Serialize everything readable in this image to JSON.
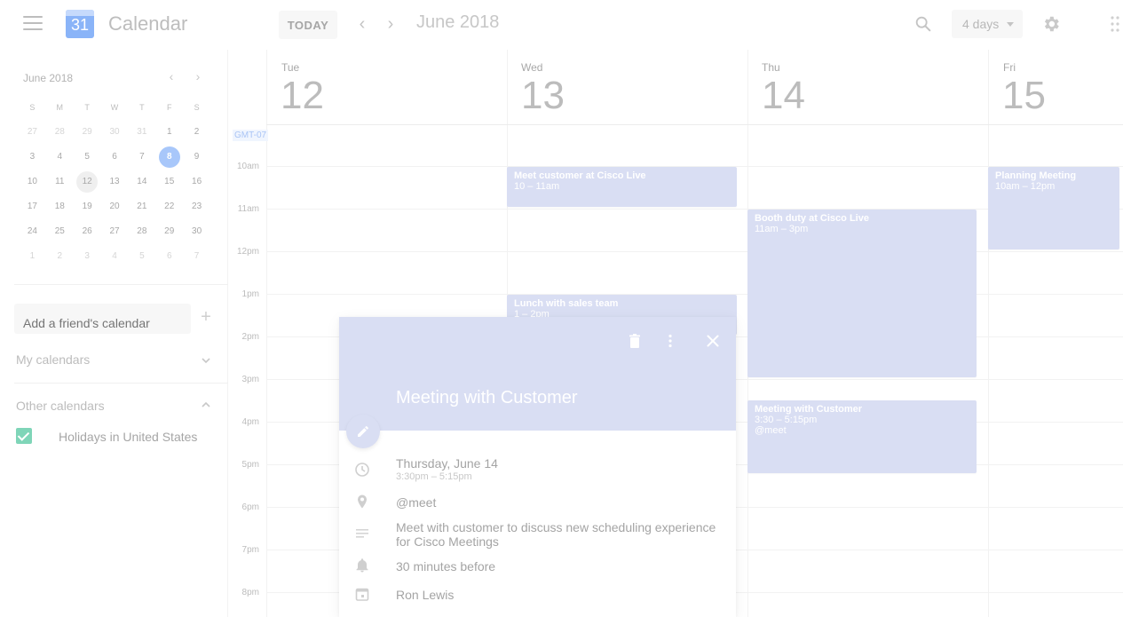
{
  "app": {
    "title": "Calendar",
    "logo_text": "31"
  },
  "toolbar": {
    "today_label": "TODAY",
    "prev_label": "‹",
    "next_label": "›",
    "month_title": "June 2018",
    "view_label": "4 days"
  },
  "mini_calendar": {
    "title": "June 2018",
    "prev_label": "‹",
    "next_label": "›",
    "weekdays": [
      "S",
      "M",
      "T",
      "W",
      "T",
      "F",
      "S"
    ],
    "weeks": [
      [
        "27",
        "28",
        "29",
        "30",
        "31",
        "1",
        "2"
      ],
      [
        "3",
        "4",
        "5",
        "6",
        "7",
        "8",
        "9"
      ],
      [
        "10",
        "11",
        "12",
        "13",
        "14",
        "15",
        "16"
      ],
      [
        "17",
        "18",
        "19",
        "20",
        "21",
        "22",
        "23"
      ],
      [
        "24",
        "25",
        "26",
        "27",
        "28",
        "29",
        "30"
      ],
      [
        "1",
        "2",
        "3",
        "4",
        "5",
        "6",
        "7"
      ]
    ],
    "today": "8",
    "selected": "12"
  },
  "sidebar": {
    "friend_placeholder": "Add a friend's calendar",
    "my_calendars": "My calendars",
    "other_calendars": "Other calendars",
    "calendars": [
      {
        "label": "Holidays in United States",
        "checked": true,
        "color": "#7fd5b8"
      }
    ]
  },
  "grid": {
    "timezone": "GMT-07",
    "days": [
      {
        "dow": "Tue",
        "num": "12"
      },
      {
        "dow": "Wed",
        "num": "13"
      },
      {
        "dow": "Thu",
        "num": "14"
      },
      {
        "dow": "Fri",
        "num": "15"
      }
    ],
    "hours": [
      "10am",
      "11am",
      "12pm",
      "1pm",
      "2pm",
      "3pm",
      "4pm",
      "5pm",
      "6pm",
      "7pm",
      "8pm"
    ]
  },
  "events": {
    "cisco_live": {
      "title": "Meet customer at Cisco Live",
      "time": "10 – 11am"
    },
    "planning": {
      "title": "Planning Meeting",
      "time": "10am – 12pm"
    },
    "booth": {
      "title": "Booth duty at Cisco Live",
      "time": "11am – 3pm"
    },
    "lunch": {
      "title": "Lunch with sales team",
      "time": "1 – 2pm"
    },
    "customer": {
      "title": "Meeting with Customer",
      "time": "3:30 – 5:15pm",
      "location": "@meet"
    }
  },
  "popup": {
    "title": "Meeting with Customer",
    "date": "Thursday, June 14",
    "time": "3:30pm – 5:15pm",
    "location": "@meet",
    "description_line1": "Meet with customer to discuss new scheduling experience",
    "description_line2": "for Cisco Meetings",
    "reminder": "30 minutes before",
    "organizer": "Ron Lewis"
  },
  "colors": {
    "event": "#d9def3",
    "accent": "#a8c7fa",
    "checkbox": "#7fd5b8"
  }
}
